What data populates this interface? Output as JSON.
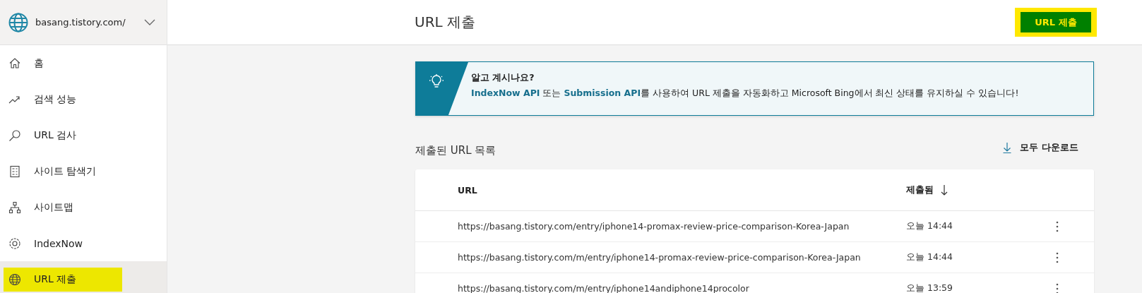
{
  "site_picker": {
    "label": "basang.tistory.com/"
  },
  "nav": [
    {
      "label": "홈",
      "kind": "home",
      "selected": false,
      "highlighted": false
    },
    {
      "label": "검색 성능",
      "kind": "trend",
      "selected": false,
      "highlighted": false
    },
    {
      "label": "URL 검사",
      "kind": "search",
      "selected": false,
      "highlighted": false
    },
    {
      "label": "사이트 탐색기",
      "kind": "list",
      "selected": false,
      "highlighted": false
    },
    {
      "label": "사이트맵",
      "kind": "tree",
      "selected": false,
      "highlighted": false
    },
    {
      "label": "IndexNow",
      "kind": "gear",
      "selected": false,
      "highlighted": false
    },
    {
      "label": "URL 제출",
      "kind": "globe",
      "selected": true,
      "highlighted": true
    }
  ],
  "page_title": "URL 제출",
  "submit_button": {
    "label": "URL 제출",
    "highlighted": true
  },
  "banner": {
    "title": "알고 계시나요?",
    "link_1": "IndexNow API",
    "text_1": " 또는 ",
    "link_2": "Submission API",
    "text_2": "를 사용하여 URL 제출을 자동화하고 Microsoft Bing에서 최신 상태를 유지하실 수 있습니다!"
  },
  "list_title": "제출된 URL 목록",
  "download_button": "모두 다운로드",
  "table": {
    "columns": [
      {
        "label": "URL"
      },
      {
        "label": "제출됨"
      }
    ],
    "rows": [
      {
        "url": "https://basang.tistory.com/entry/iphone14-promax-review-price-comparison-Korea-Japan",
        "submitted": "오늘 14:44"
      },
      {
        "url": "https://basang.tistory.com/m/entry/iphone14-promax-review-price-comparison-Korea-Japan",
        "submitted": "오늘 14:44"
      },
      {
        "url": "https://basang.tistory.com/m/entry/iphone14andiphone14procolor",
        "submitted": "오늘 13:59"
      }
    ]
  }
}
